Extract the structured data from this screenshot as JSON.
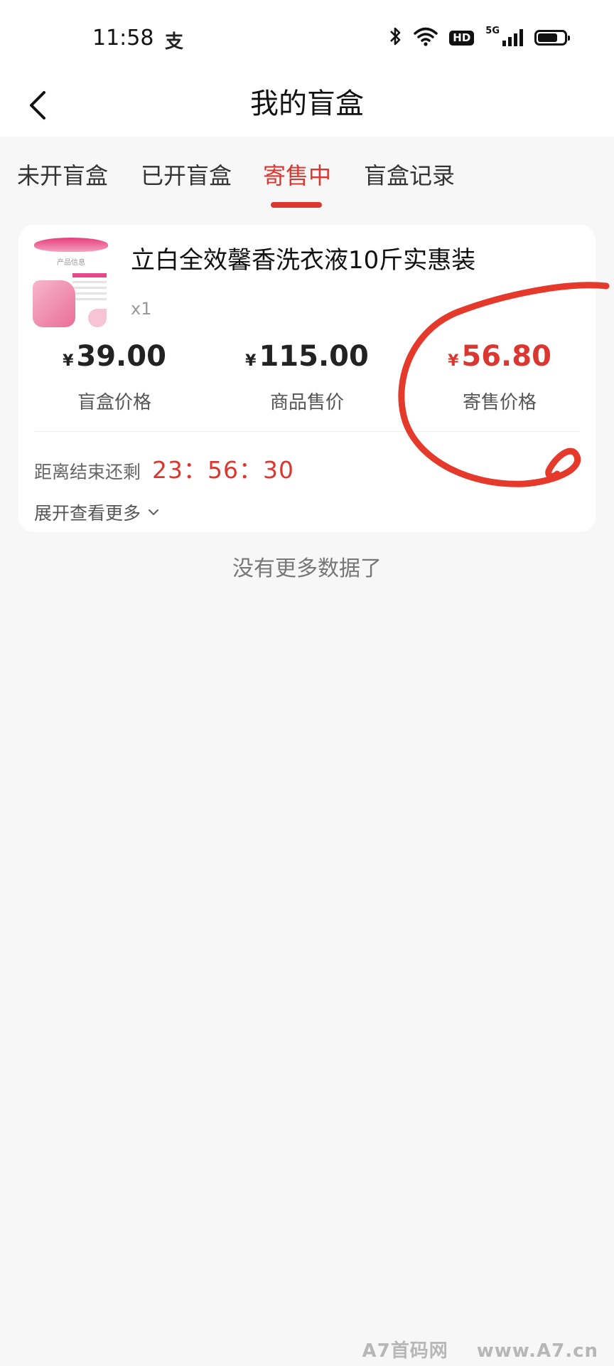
{
  "status_bar": {
    "time": "11:58",
    "app_icon": "支",
    "hd_badge": "HD",
    "network_label": "5G",
    "icons": [
      "bluetooth-icon",
      "wifi-icon",
      "hd-icon",
      "signal-icon",
      "battery-icon"
    ]
  },
  "nav": {
    "back_icon": "chevron-left-icon",
    "title": "我的盲盒"
  },
  "tabs": [
    {
      "label": "未开盲盒",
      "active": false
    },
    {
      "label": "已开盲盒",
      "active": false
    },
    {
      "label": "寄售中",
      "active": true
    },
    {
      "label": "盲盒记录",
      "active": false
    }
  ],
  "card": {
    "thumb_text": "产品信息",
    "product_name": "立白全效馨香洗衣液10斤实惠装",
    "quantity": "x1",
    "currency": "¥",
    "prices": [
      {
        "value": "39.00",
        "label": "盲盒价格",
        "highlight": false
      },
      {
        "value": "115.00",
        "label": "商品售价",
        "highlight": false
      },
      {
        "value": "56.80",
        "label": "寄售价格",
        "highlight": true
      }
    ],
    "countdown_label": "距离结束还剩",
    "countdown_value": "23：56：30",
    "expand_label": "展开查看更多"
  },
  "footer": {
    "no_more_text": "没有更多数据了"
  },
  "watermark": {
    "left": "A7首码网",
    "right": "www.A7.cn"
  },
  "colors": {
    "accent": "#d9372f",
    "background": "#f7f7f7",
    "card": "#ffffff",
    "annotation": "#e53a2b"
  }
}
